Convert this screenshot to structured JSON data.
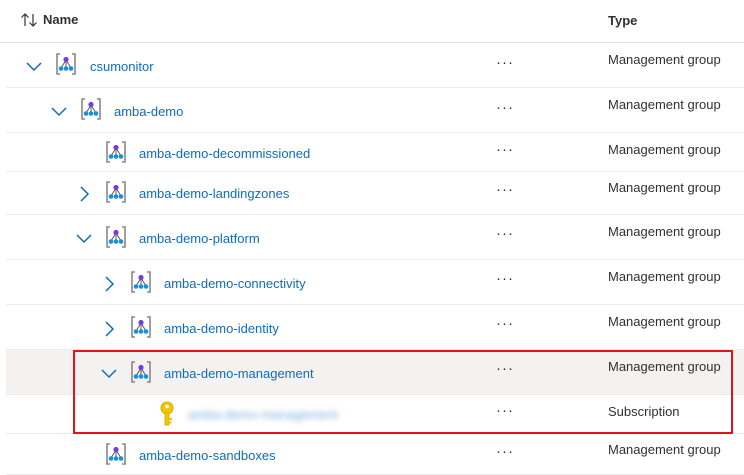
{
  "header": {
    "sort_icon": "sort-arrows-icon",
    "name_label": "Name",
    "type_label": "Type"
  },
  "rows": [
    {
      "name": "csumonitor",
      "type": "Management group",
      "expander": "expanded",
      "icon": "management-group-icon",
      "actions": "···"
    },
    {
      "name": "amba-demo",
      "type": "Management group",
      "expander": "expanded",
      "icon": "management-group-icon",
      "actions": "···"
    },
    {
      "name": "amba-demo-decommissioned",
      "type": "Management group",
      "expander": "none",
      "icon": "management-group-icon",
      "actions": "···"
    },
    {
      "name": "amba-demo-landingzones",
      "type": "Management group",
      "expander": "collapsed",
      "icon": "management-group-icon",
      "actions": "···"
    },
    {
      "name": "amba-demo-platform",
      "type": "Management group",
      "expander": "expanded",
      "icon": "management-group-icon",
      "actions": "···"
    },
    {
      "name": "amba-demo-connectivity",
      "type": "Management group",
      "expander": "collapsed",
      "icon": "management-group-icon",
      "actions": "···"
    },
    {
      "name": "amba-demo-identity",
      "type": "Management group",
      "expander": "collapsed",
      "icon": "management-group-icon",
      "actions": "···"
    },
    {
      "name": "amba-demo-management",
      "type": "Management group",
      "expander": "expanded",
      "icon": "management-group-icon",
      "actions": "···",
      "selected": true
    },
    {
      "name": "amba-demo-management",
      "type": "Subscription",
      "expander": "none",
      "icon": "subscription-key-icon",
      "actions": "···",
      "redacted": true
    },
    {
      "name": "amba-demo-sandboxes",
      "type": "Management group",
      "expander": "none",
      "icon": "management-group-icon",
      "actions": "···"
    }
  ],
  "colors": {
    "link": "#0f6cbd",
    "highlight_border": "#e3121b",
    "selected_row": "#f3f2f1",
    "key": "#f5c400"
  }
}
